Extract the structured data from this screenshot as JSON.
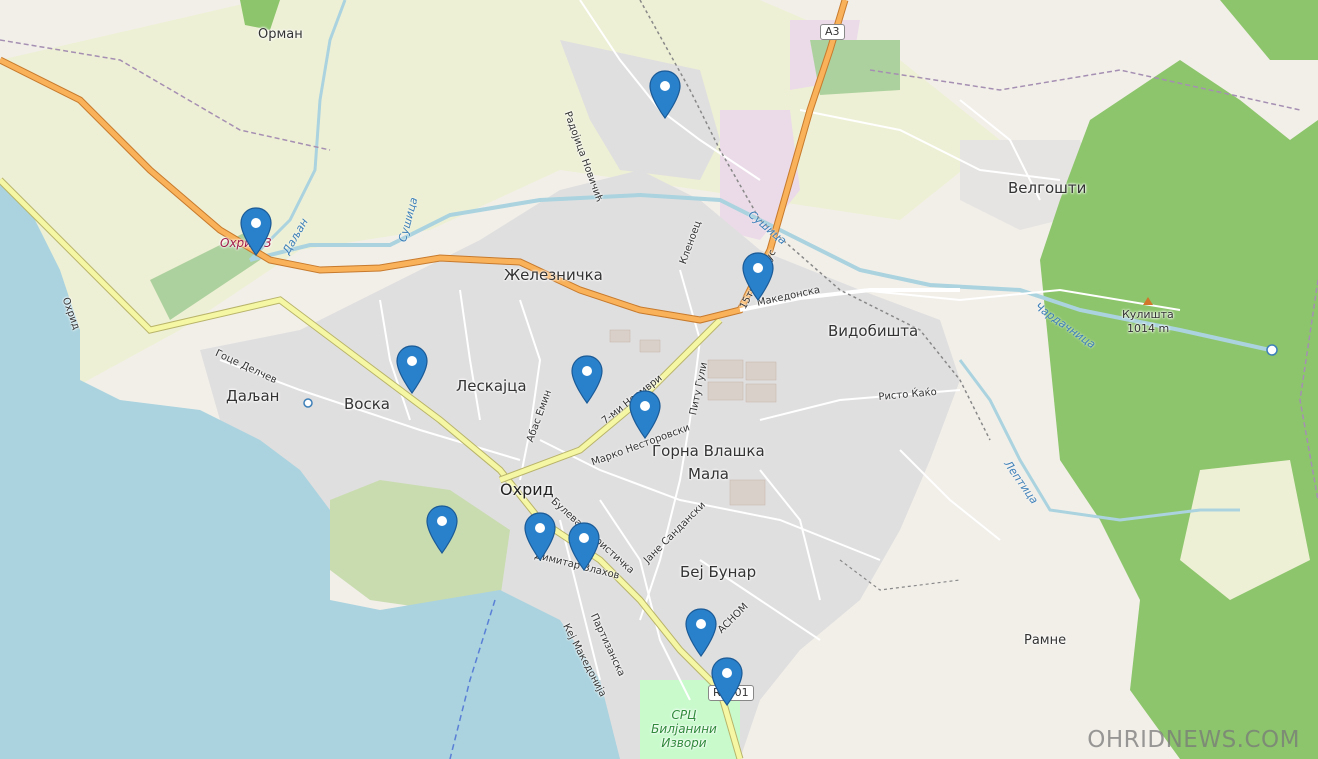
{
  "map": {
    "places": {
      "orman": "Орман",
      "velgoshti": "Велгошти",
      "zheleznichka": "Железничка",
      "vidobishta": "Видобишта",
      "leskajca": "Лескајца",
      "voska": "Воска",
      "daljan": "Даљан",
      "ohrid": "Охрид",
      "gorna_vlashka": "Горна Влашка",
      "mala": "Мала",
      "bej_bunar": "Беј Бунар",
      "ramne": "Рамне"
    },
    "roads": {
      "radojica": "Радојица Новичић",
      "klenoec": "Кленоец",
      "makedonska": "Македонска",
      "fifteenth_korpus": "15ти Корпус",
      "goce": "Гоце Делчев",
      "abas": "Абас Емин",
      "sedmi": "7-ми Ноември",
      "pitu": "Питу Гули",
      "marko": "Марко Несторовски",
      "risto": "Ристо Ќаќо",
      "bulevar": "Булевар Туристичка",
      "dimitar": "Димитар Влахов",
      "jane": "Јане Сандански",
      "partizanska": "Партизанска",
      "kej": "Кеј Македонија",
      "avnoj": "АСНОМ",
      "ohrid_road": "Охрид"
    },
    "water": {
      "sushica1": "Сушица",
      "sushica2": "Сушица",
      "daljan_river": "Даљан",
      "chardachnica": "Чардачница",
      "leptnica": "Лептица"
    },
    "other": {
      "rail_station": "Охрид 3",
      "park": "СРЦ Билјанини Извори",
      "peak_name": "Кулишта",
      "peak_elev": "1014 m",
      "shield_a3": "A3",
      "shield_r1": "R1501"
    },
    "marker_count": 12,
    "watermark": "OHRIDNEWS.COM"
  },
  "colors": {
    "lake": "#aad3df",
    "land": "#f2efe9",
    "urban": "#e0dfdf",
    "forest": "#8dc56c",
    "farmland": "#eef0d5",
    "trunk_road": "#f9b25a",
    "primary_road": "#f6f7a4",
    "marker": "#2a81cb"
  }
}
